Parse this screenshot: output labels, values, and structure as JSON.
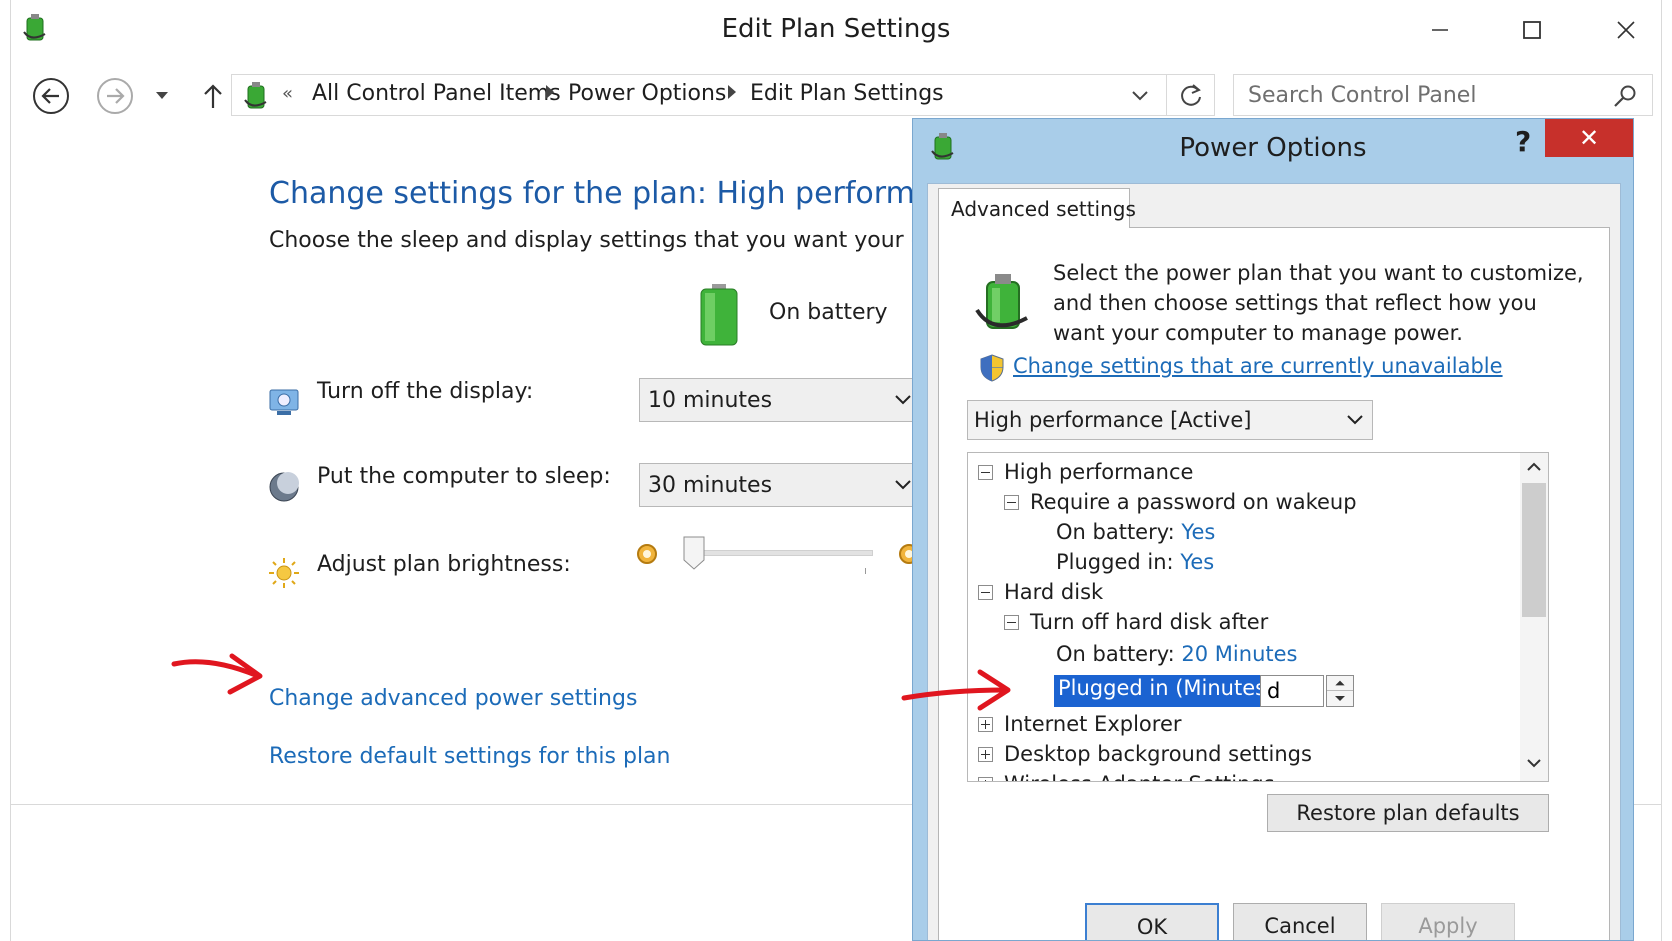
{
  "window": {
    "title": "Edit Plan Settings"
  },
  "address": {
    "overflow": "«",
    "crumbs": [
      "All Control Panel Items",
      "Power Options",
      "Edit Plan Settings"
    ]
  },
  "search": {
    "placeholder": "Search Control Panel"
  },
  "main": {
    "title": "Change settings for the plan: High performance",
    "subtitle": "Choose the sleep and display settings that you want your computer to use.",
    "column_header": "On battery",
    "display_label": "Turn off the display:",
    "display_value": "10 minutes",
    "sleep_label": "Put the computer to sleep:",
    "sleep_value": "30 minutes",
    "brightness_label": "Adjust plan brightness:",
    "brightness_level": 0.05,
    "advanced_link": "Change advanced power settings",
    "restore_link": "Restore default settings for this plan"
  },
  "dialog": {
    "title": "Power Options",
    "help": "?",
    "close": "✕",
    "tab": "Advanced settings",
    "intro": "Select the power plan that you want to customize, and then choose settings that reflect how you want your computer to manage power.",
    "unavailable_link": "Change settings that are currently unavailable",
    "plan_value": "High performance [Active]",
    "tree": {
      "plan": "High performance",
      "password": "Require a password on wakeup",
      "on_battery_label": "On battery:",
      "on_battery_value": "Yes",
      "plugged_label": "Plugged in:",
      "plugged_value": "Yes",
      "hard_disk": "Hard disk",
      "turn_off_hd": "Turn off hard disk after",
      "hd_battery_label": "On battery:",
      "hd_battery_value": "20 Minutes",
      "hd_plugged_label": "Plugged in (Minutes):",
      "hd_plugged_input": "d",
      "internet_explorer": "Internet Explorer",
      "desktop_bg": "Desktop background settings",
      "wireless": "Wireless Adapter Settings"
    },
    "restore_button": "Restore plan defaults",
    "ok": "OK",
    "cancel": "Cancel",
    "apply": "Apply"
  },
  "colors": {
    "accent": "#1c6bb8",
    "title_blue": "#1c5aa6",
    "selection": "#1b63d1",
    "annotation_arrow": "#e0161f",
    "dialog_frame": "#a9cde9",
    "close_red": "#c7302b"
  },
  "icons": [
    "power-plan-icon",
    "back-icon",
    "forward-icon",
    "up-icon",
    "refresh-icon",
    "search-icon",
    "battery-icon",
    "display-icon",
    "sleep-icon",
    "brightness-icon",
    "shield-icon"
  ]
}
